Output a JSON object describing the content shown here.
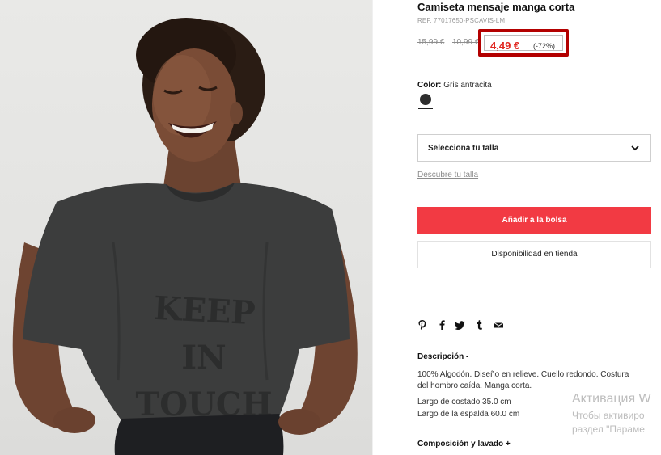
{
  "product": {
    "title": "Camiseta mensaje manga corta",
    "ref": "REF. 77017650-PSCAVIS-LM",
    "original_price": "15,99 €",
    "previous_price": "10,99 €",
    "sale_price": "4,49 €",
    "discount": "(-72%)",
    "shirt_print": [
      "KEEP",
      "IN",
      "TOUCH"
    ]
  },
  "color": {
    "label": "Color:",
    "value": "Gris antracita",
    "swatch_hex": "#2e2e2e"
  },
  "size": {
    "select_label": "Selecciona tu talla",
    "guide_link": "Descubre tu talla"
  },
  "actions": {
    "add_to_bag": "Añadir a la bolsa",
    "store_availability": "Disponibilidad en tienda"
  },
  "share_icons": [
    "pinterest-icon",
    "facebook-icon",
    "twitter-icon",
    "tumblr-icon",
    "email-icon"
  ],
  "description": {
    "heading": "Descripción  -",
    "text_line1": "100% Algodón. Diseño en relieve. Cuello redondo. Costura",
    "text_line2": "del hombro caída. Manga corta.",
    "measure1": "Largo de costado 35.0 cm",
    "measure2": "Largo de la espalda 60.0 cm"
  },
  "composition": {
    "heading": "Composición y lavado  +"
  },
  "windows_activation": {
    "line1": "Активация W",
    "line2": "Чтобы активиро",
    "line3": "раздел \"Параме"
  },
  "colors": {
    "accent_red": "#f23a43",
    "sale_red": "#e0261f",
    "highlight_box": "#b30000"
  }
}
